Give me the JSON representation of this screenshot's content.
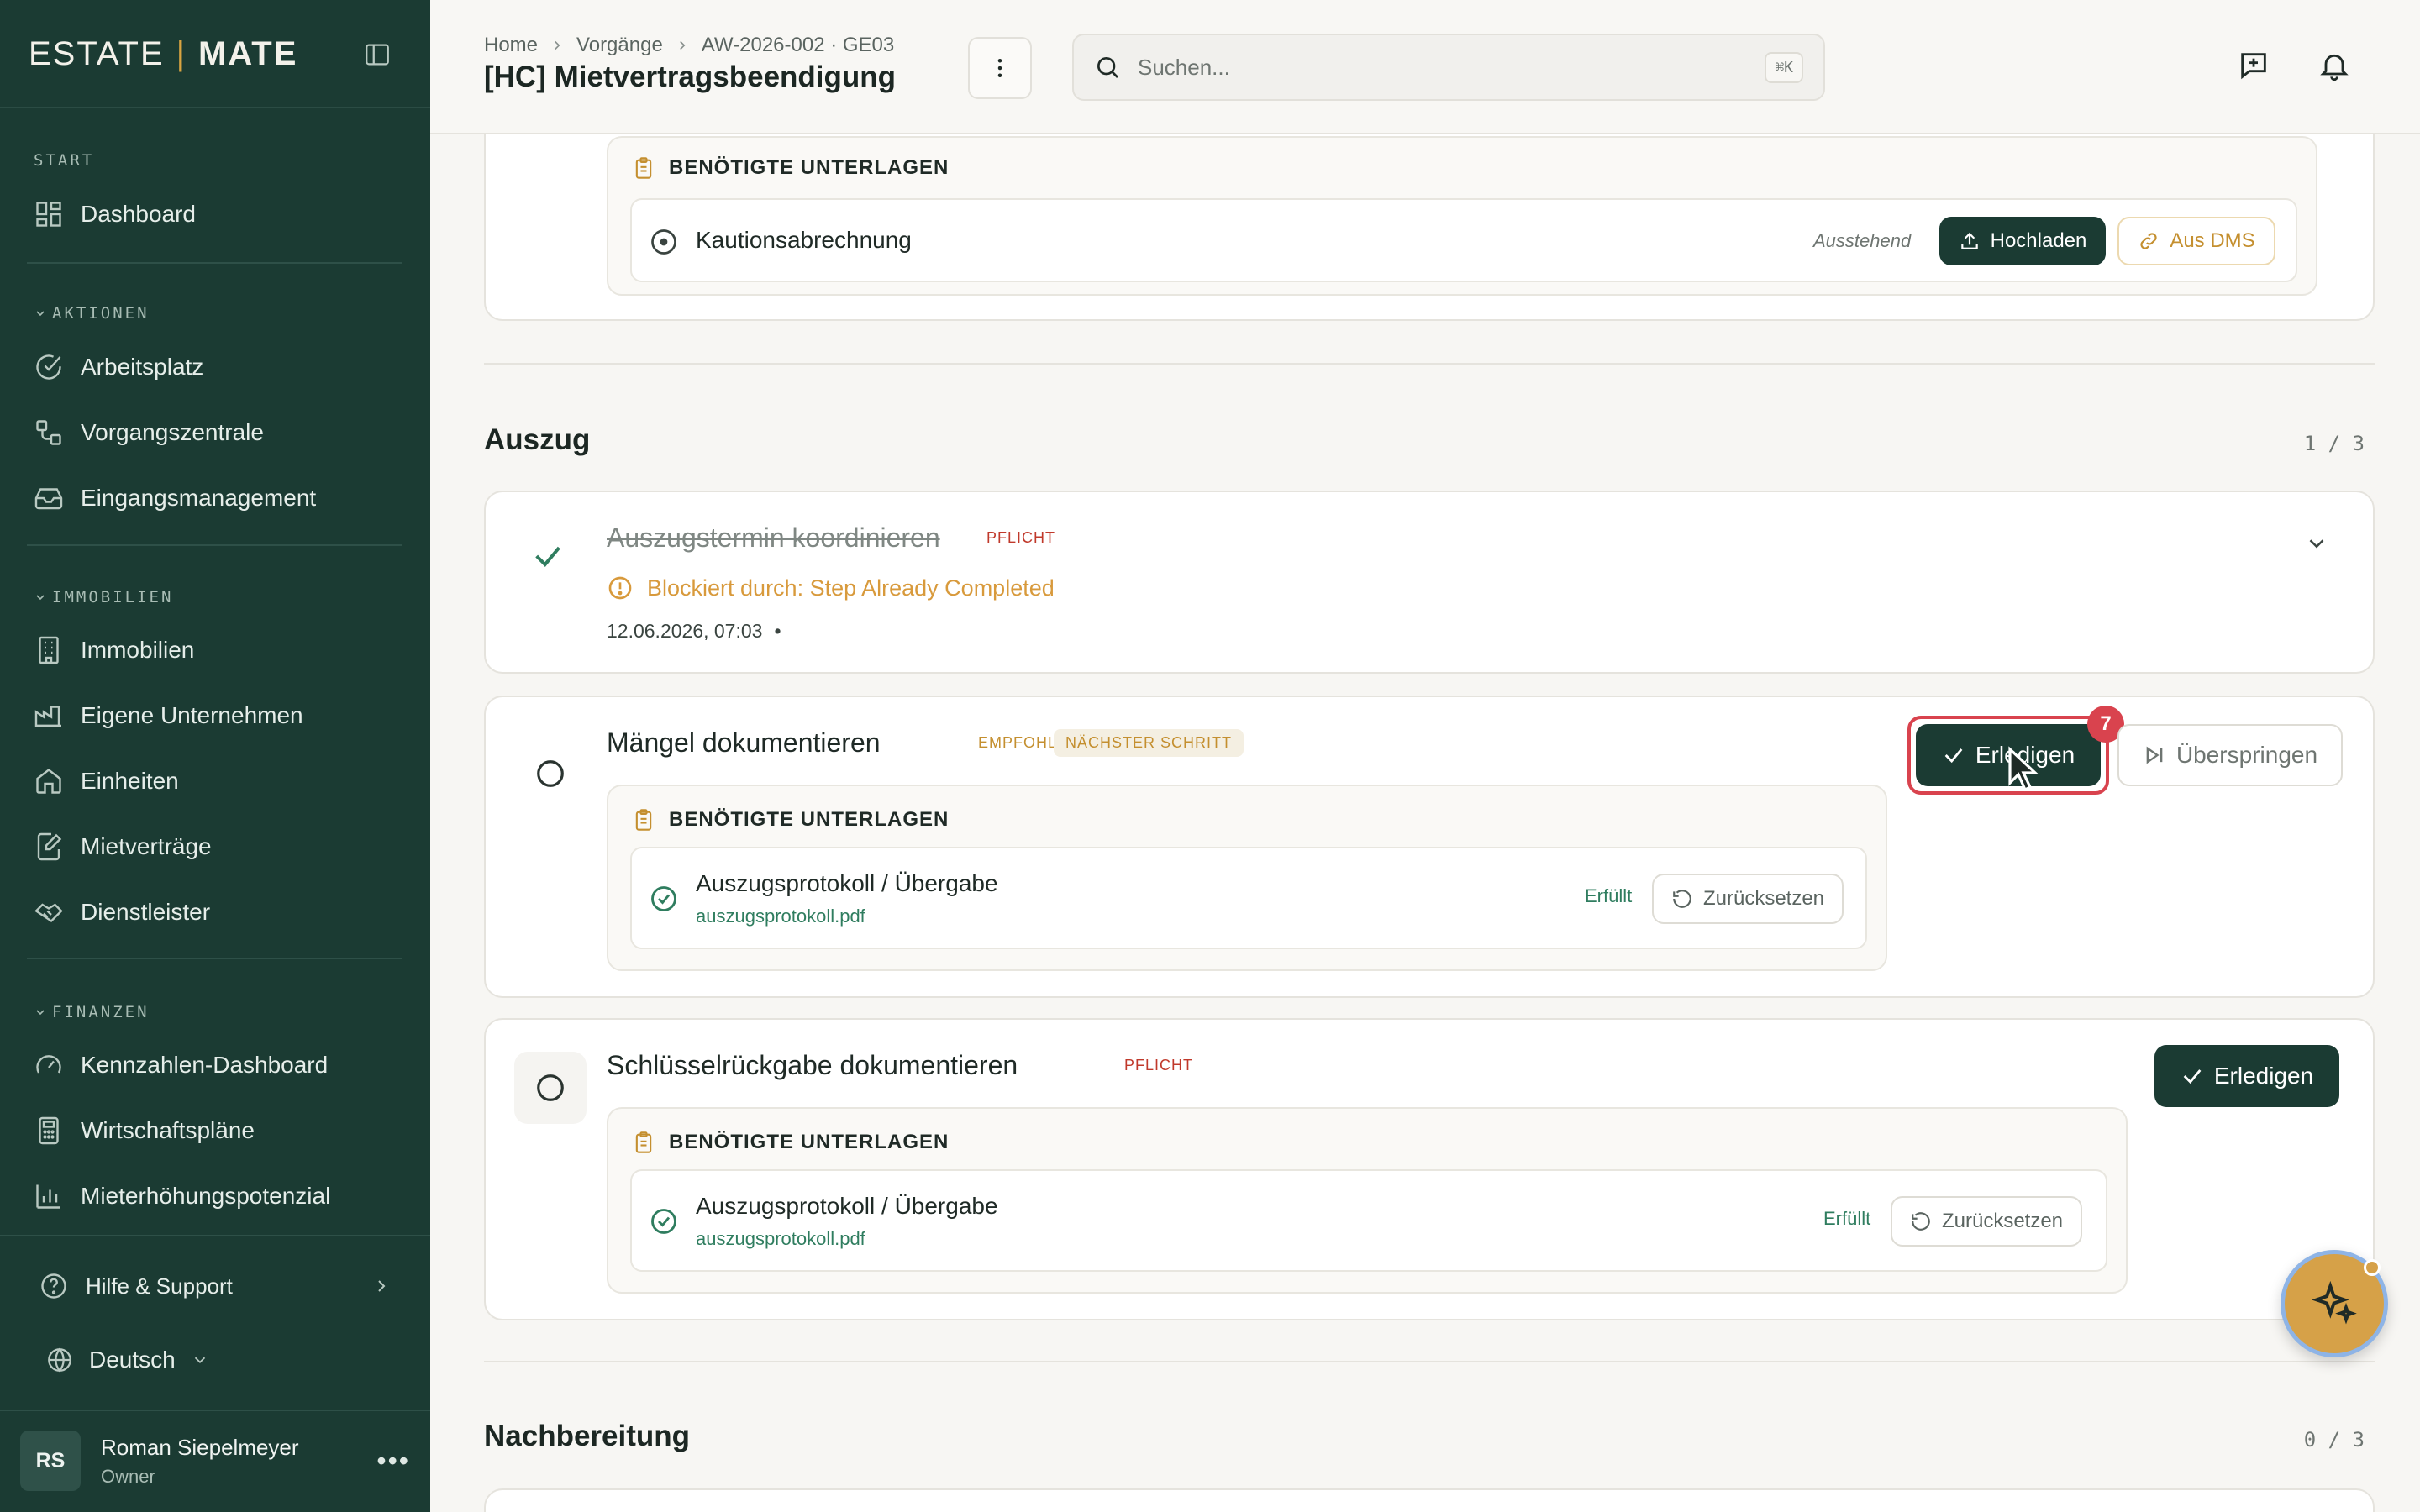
{
  "brand": {
    "left": "ESTATE",
    "sep": "|",
    "right": "MATE"
  },
  "sidebar": {
    "start_label": "START",
    "dashboard": "Dashboard",
    "sections": {
      "aktionen": "AKTIONEN",
      "immobilien": "IMMOBILIEN",
      "finanzen": "FINANZEN"
    },
    "aktionen_items": [
      "Arbeitsplatz",
      "Vorgangszentrale",
      "Eingangsmanagement"
    ],
    "immobilien_items": [
      "Immobilien",
      "Eigene Unternehmen",
      "Einheiten",
      "Mietverträge",
      "Dienstleister"
    ],
    "finanzen_items": [
      "Kennzahlen-Dashboard",
      "Wirtschaftspläne",
      "Mieterhöhungspotenzial"
    ],
    "help": "Hilfe & Support",
    "language": "Deutsch",
    "user": {
      "initials": "RS",
      "name": "Roman Siepelmeyer",
      "role": "Owner",
      "more": "•••"
    }
  },
  "header": {
    "breadcrumb": [
      "Home",
      "Vorgänge",
      "AW-2026-002 · GE03"
    ],
    "title": "[HC] Mietvertragsbeendigung",
    "search_placeholder": "Suchen...",
    "search_shortcut": "⌘K"
  },
  "top_card": {
    "docs_title": "BENÖTIGTE UNTERLAGEN",
    "doc_name": "Kautionsabrechnung",
    "status": "Ausstehend",
    "upload": "Hochladen",
    "dms": "Aus DMS"
  },
  "auszug": {
    "title": "Auszug",
    "count": "1 / 3",
    "step1": {
      "title": "Auszugstermin koordinieren",
      "tag": "PFLICHT",
      "blocked": "Blockiert durch: Step Already Completed",
      "timestamp": "12.06.2026, 07:03",
      "dot": "•"
    },
    "step2": {
      "title": "Mängel dokumentieren",
      "tag1": "EMPFOHLEN",
      "tag2": "NÄCHSTER SCHRITT",
      "docs_title": "BENÖTIGTE UNTERLAGEN",
      "doc_name": "Auszugsprotokoll / Übergabe",
      "doc_file": "auszugsprotokoll.pdf",
      "status": "Erfüllt",
      "reset": "Zurücksetzen",
      "complete": "Erledigen",
      "badge": "7",
      "skip": "Überspringen"
    },
    "step3": {
      "title": "Schlüsselrückgabe dokumentieren",
      "tag": "PFLICHT",
      "docs_title": "BENÖTIGTE UNTERLAGEN",
      "doc_name": "Auszugsprotokoll / Übergabe",
      "doc_file": "auszugsprotokoll.pdf",
      "status": "Erfüllt",
      "reset": "Zurücksetzen",
      "complete": "Erledigen"
    }
  },
  "nachbereitung": {
    "title": "Nachbereitung",
    "count": "0 / 3"
  },
  "colors": {
    "sidebar": "#1b3b33",
    "accent_gold": "#d6a148",
    "success": "#2f7d5f",
    "danger": "#c0392b"
  }
}
